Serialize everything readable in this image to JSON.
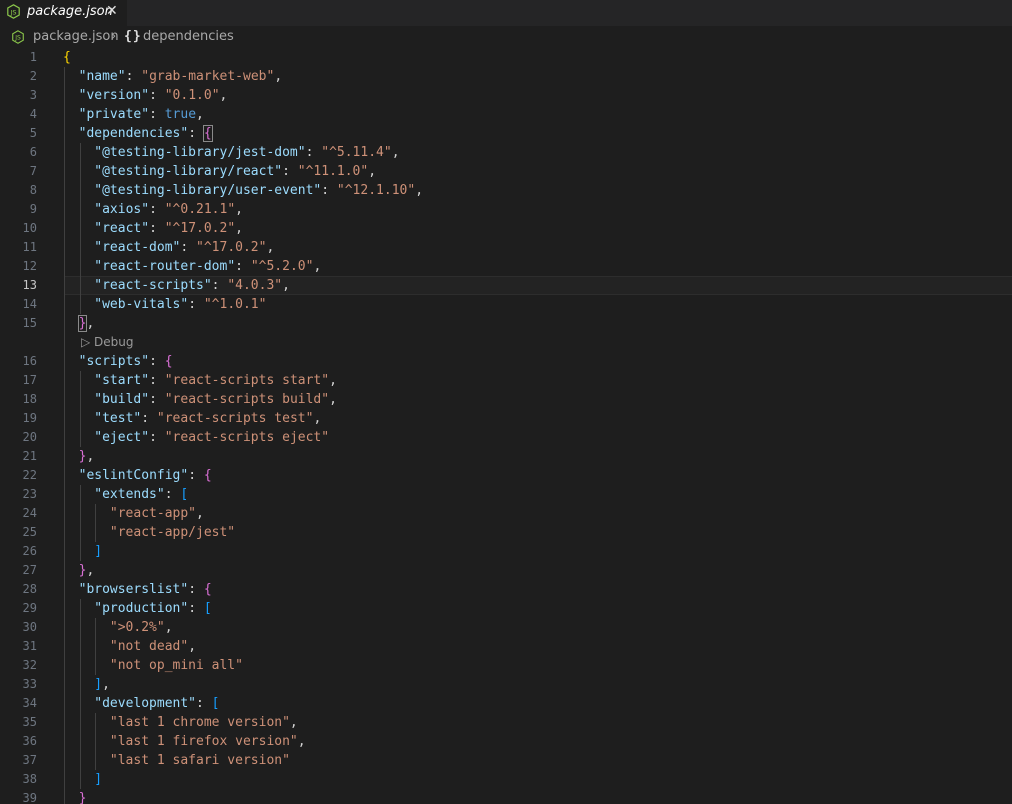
{
  "tab": {
    "title": "package.json",
    "close_glyph": "✕",
    "icon": "json-file-icon"
  },
  "breadcrumb": {
    "file": "package.json",
    "separator": "›",
    "object_icon": "{}",
    "key": "dependencies"
  },
  "codelens": {
    "label": "▷ Debug"
  },
  "colors": {
    "background": "#1e1e1e",
    "key": "#9cdcfe",
    "string": "#ce9178",
    "keyword": "#569cd6",
    "bracket_level1": "#ffd700",
    "bracket_level2": "#da70d6",
    "bracket_level3": "#179fff"
  },
  "current_line": 13,
  "lines": [
    {
      "n": "1",
      "indent": 0,
      "tokens": [
        {
          "t": "{",
          "c": "b1"
        }
      ]
    },
    {
      "n": "2",
      "indent": 1,
      "tokens": [
        {
          "t": "\"name\"",
          "c": "k"
        },
        {
          "t": ": ",
          "c": "p"
        },
        {
          "t": "\"grab-market-web\"",
          "c": "s"
        },
        {
          "t": ",",
          "c": "p"
        }
      ]
    },
    {
      "n": "3",
      "indent": 1,
      "tokens": [
        {
          "t": "\"version\"",
          "c": "k"
        },
        {
          "t": ": ",
          "c": "p"
        },
        {
          "t": "\"0.1.0\"",
          "c": "s"
        },
        {
          "t": ",",
          "c": "p"
        }
      ]
    },
    {
      "n": "4",
      "indent": 1,
      "tokens": [
        {
          "t": "\"private\"",
          "c": "k"
        },
        {
          "t": ": ",
          "c": "p"
        },
        {
          "t": "true",
          "c": "kw"
        },
        {
          "t": ",",
          "c": "p"
        }
      ]
    },
    {
      "n": "5",
      "indent": 1,
      "tokens": [
        {
          "t": "\"dependencies\"",
          "c": "k"
        },
        {
          "t": ": ",
          "c": "p"
        },
        {
          "t": "{",
          "c": "b2",
          "m": true
        }
      ]
    },
    {
      "n": "6",
      "indent": 2,
      "tokens": [
        {
          "t": "\"@testing-library/jest-dom\"",
          "c": "k"
        },
        {
          "t": ": ",
          "c": "p"
        },
        {
          "t": "\"^5.11.4\"",
          "c": "s"
        },
        {
          "t": ",",
          "c": "p"
        }
      ]
    },
    {
      "n": "7",
      "indent": 2,
      "tokens": [
        {
          "t": "\"@testing-library/react\"",
          "c": "k"
        },
        {
          "t": ": ",
          "c": "p"
        },
        {
          "t": "\"^11.1.0\"",
          "c": "s"
        },
        {
          "t": ",",
          "c": "p"
        }
      ]
    },
    {
      "n": "8",
      "indent": 2,
      "tokens": [
        {
          "t": "\"@testing-library/user-event\"",
          "c": "k"
        },
        {
          "t": ": ",
          "c": "p"
        },
        {
          "t": "\"^12.1.10\"",
          "c": "s"
        },
        {
          "t": ",",
          "c": "p"
        }
      ]
    },
    {
      "n": "9",
      "indent": 2,
      "tokens": [
        {
          "t": "\"axios\"",
          "c": "k"
        },
        {
          "t": ": ",
          "c": "p"
        },
        {
          "t": "\"^0.21.1\"",
          "c": "s"
        },
        {
          "t": ",",
          "c": "p"
        }
      ]
    },
    {
      "n": "10",
      "indent": 2,
      "tokens": [
        {
          "t": "\"react\"",
          "c": "k"
        },
        {
          "t": ": ",
          "c": "p"
        },
        {
          "t": "\"^17.0.2\"",
          "c": "s"
        },
        {
          "t": ",",
          "c": "p"
        }
      ]
    },
    {
      "n": "11",
      "indent": 2,
      "tokens": [
        {
          "t": "\"react-dom\"",
          "c": "k"
        },
        {
          "t": ": ",
          "c": "p"
        },
        {
          "t": "\"^17.0.2\"",
          "c": "s"
        },
        {
          "t": ",",
          "c": "p"
        }
      ]
    },
    {
      "n": "12",
      "indent": 2,
      "tokens": [
        {
          "t": "\"react-router-dom\"",
          "c": "k"
        },
        {
          "t": ": ",
          "c": "p"
        },
        {
          "t": "\"^5.2.0\"",
          "c": "s"
        },
        {
          "t": ",",
          "c": "p"
        }
      ]
    },
    {
      "n": "13",
      "indent": 2,
      "tokens": [
        {
          "t": "\"react-scripts\"",
          "c": "k"
        },
        {
          "t": ": ",
          "c": "p"
        },
        {
          "t": "\"4.0.3\"",
          "c": "s"
        },
        {
          "t": ",",
          "c": "p"
        }
      ]
    },
    {
      "n": "14",
      "indent": 2,
      "tokens": [
        {
          "t": "\"web-vitals\"",
          "c": "k"
        },
        {
          "t": ": ",
          "c": "p"
        },
        {
          "t": "\"^1.0.1\"",
          "c": "s"
        }
      ]
    },
    {
      "n": "15",
      "indent": 1,
      "tokens": [
        {
          "t": "}",
          "c": "b2",
          "m": true
        },
        {
          "t": ",",
          "c": "p"
        }
      ],
      "codelens_after": true
    },
    {
      "n": "16",
      "indent": 1,
      "tokens": [
        {
          "t": "\"scripts\"",
          "c": "k"
        },
        {
          "t": ": ",
          "c": "p"
        },
        {
          "t": "{",
          "c": "b2"
        }
      ]
    },
    {
      "n": "17",
      "indent": 2,
      "tokens": [
        {
          "t": "\"start\"",
          "c": "k"
        },
        {
          "t": ": ",
          "c": "p"
        },
        {
          "t": "\"react-scripts start\"",
          "c": "s"
        },
        {
          "t": ",",
          "c": "p"
        }
      ]
    },
    {
      "n": "18",
      "indent": 2,
      "tokens": [
        {
          "t": "\"build\"",
          "c": "k"
        },
        {
          "t": ": ",
          "c": "p"
        },
        {
          "t": "\"react-scripts build\"",
          "c": "s"
        },
        {
          "t": ",",
          "c": "p"
        }
      ]
    },
    {
      "n": "19",
      "indent": 2,
      "tokens": [
        {
          "t": "\"test\"",
          "c": "k"
        },
        {
          "t": ": ",
          "c": "p"
        },
        {
          "t": "\"react-scripts test\"",
          "c": "s"
        },
        {
          "t": ",",
          "c": "p"
        }
      ]
    },
    {
      "n": "20",
      "indent": 2,
      "tokens": [
        {
          "t": "\"eject\"",
          "c": "k"
        },
        {
          "t": ": ",
          "c": "p"
        },
        {
          "t": "\"react-scripts eject\"",
          "c": "s"
        }
      ]
    },
    {
      "n": "21",
      "indent": 1,
      "tokens": [
        {
          "t": "}",
          "c": "b2"
        },
        {
          "t": ",",
          "c": "p"
        }
      ]
    },
    {
      "n": "22",
      "indent": 1,
      "tokens": [
        {
          "t": "\"eslintConfig\"",
          "c": "k"
        },
        {
          "t": ": ",
          "c": "p"
        },
        {
          "t": "{",
          "c": "b2"
        }
      ]
    },
    {
      "n": "23",
      "indent": 2,
      "tokens": [
        {
          "t": "\"extends\"",
          "c": "k"
        },
        {
          "t": ": ",
          "c": "p"
        },
        {
          "t": "[",
          "c": "b3"
        }
      ]
    },
    {
      "n": "24",
      "indent": 3,
      "tokens": [
        {
          "t": "\"react-app\"",
          "c": "s"
        },
        {
          "t": ",",
          "c": "p"
        }
      ]
    },
    {
      "n": "25",
      "indent": 3,
      "tokens": [
        {
          "t": "\"react-app/jest\"",
          "c": "s"
        }
      ]
    },
    {
      "n": "26",
      "indent": 2,
      "tokens": [
        {
          "t": "]",
          "c": "b3"
        }
      ]
    },
    {
      "n": "27",
      "indent": 1,
      "tokens": [
        {
          "t": "}",
          "c": "b2"
        },
        {
          "t": ",",
          "c": "p"
        }
      ]
    },
    {
      "n": "28",
      "indent": 1,
      "tokens": [
        {
          "t": "\"browserslist\"",
          "c": "k"
        },
        {
          "t": ": ",
          "c": "p"
        },
        {
          "t": "{",
          "c": "b2"
        }
      ]
    },
    {
      "n": "29",
      "indent": 2,
      "tokens": [
        {
          "t": "\"production\"",
          "c": "k"
        },
        {
          "t": ": ",
          "c": "p"
        },
        {
          "t": "[",
          "c": "b3"
        }
      ]
    },
    {
      "n": "30",
      "indent": 3,
      "tokens": [
        {
          "t": "\">0.2%\"",
          "c": "s"
        },
        {
          "t": ",",
          "c": "p"
        }
      ]
    },
    {
      "n": "31",
      "indent": 3,
      "tokens": [
        {
          "t": "\"not dead\"",
          "c": "s"
        },
        {
          "t": ",",
          "c": "p"
        }
      ]
    },
    {
      "n": "32",
      "indent": 3,
      "tokens": [
        {
          "t": "\"not op_mini all\"",
          "c": "s"
        }
      ]
    },
    {
      "n": "33",
      "indent": 2,
      "tokens": [
        {
          "t": "]",
          "c": "b3"
        },
        {
          "t": ",",
          "c": "p"
        }
      ]
    },
    {
      "n": "34",
      "indent": 2,
      "tokens": [
        {
          "t": "\"development\"",
          "c": "k"
        },
        {
          "t": ": ",
          "c": "p"
        },
        {
          "t": "[",
          "c": "b3"
        }
      ]
    },
    {
      "n": "35",
      "indent": 3,
      "tokens": [
        {
          "t": "\"last 1 chrome version\"",
          "c": "s"
        },
        {
          "t": ",",
          "c": "p"
        }
      ]
    },
    {
      "n": "36",
      "indent": 3,
      "tokens": [
        {
          "t": "\"last 1 firefox version\"",
          "c": "s"
        },
        {
          "t": ",",
          "c": "p"
        }
      ]
    },
    {
      "n": "37",
      "indent": 3,
      "tokens": [
        {
          "t": "\"last 1 safari version\"",
          "c": "s"
        }
      ]
    },
    {
      "n": "38",
      "indent": 2,
      "tokens": [
        {
          "t": "]",
          "c": "b3"
        }
      ]
    },
    {
      "n": "39",
      "indent": 1,
      "tokens": [
        {
          "t": "}",
          "c": "b2"
        }
      ]
    }
  ]
}
